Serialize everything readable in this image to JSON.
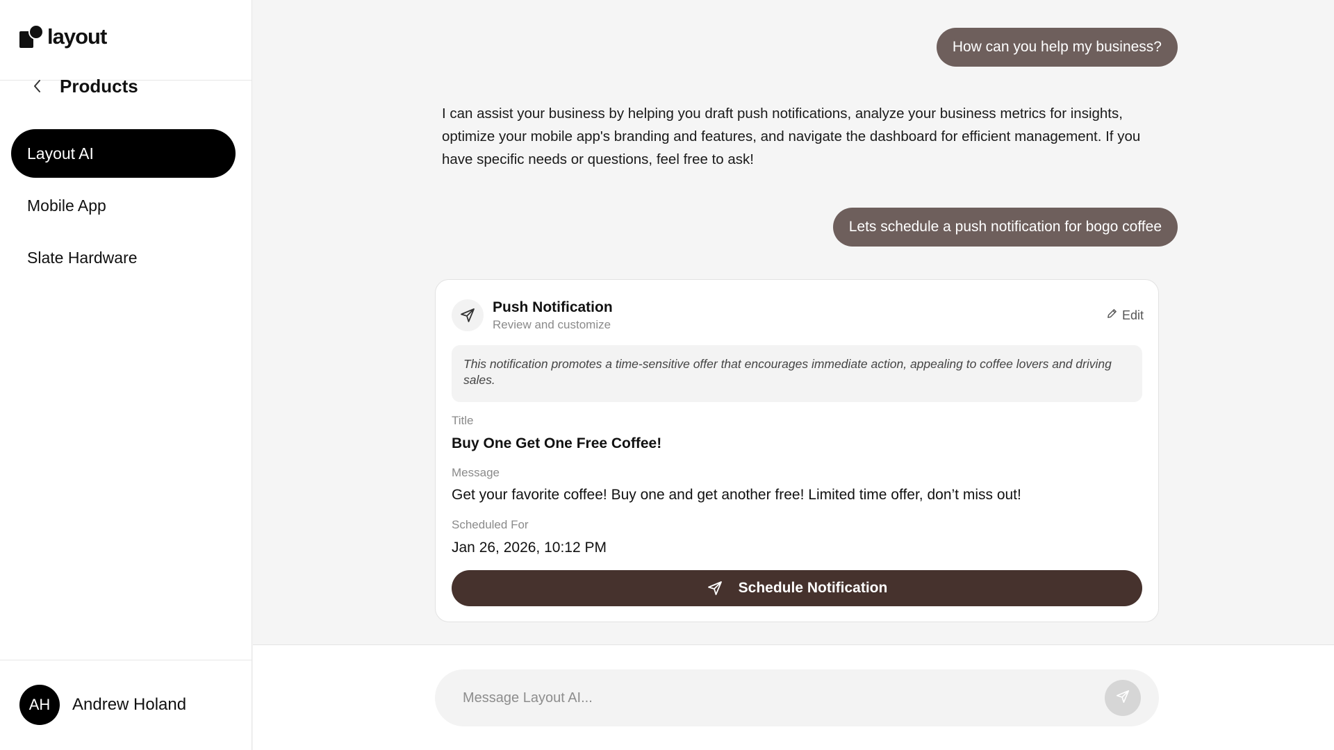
{
  "app": {
    "logo_text": "layout"
  },
  "sidebar": {
    "back_label": "Products",
    "items": [
      {
        "label": "Layout AI",
        "active": true
      },
      {
        "label": "Mobile App",
        "active": false
      },
      {
        "label": "Slate Hardware",
        "active": false
      }
    ],
    "user": {
      "initials": "AH",
      "name": "Andrew Holand"
    }
  },
  "chat": {
    "messages": [
      {
        "role": "user",
        "text": "How can you help my business?"
      },
      {
        "role": "assistant",
        "text": "I can assist your business by helping you draft push notifications, analyze your business metrics for insights, optimize your mobile app's branding and features, and navigate the dashboard for efficient management. If you have specific needs or questions, feel free to ask!"
      },
      {
        "role": "user",
        "text": "Lets schedule a push notification for bogo coffee"
      }
    ],
    "notification_card": {
      "icon": "send-icon",
      "heading": "Push Notification",
      "subheading": "Review and customize",
      "edit_label": "Edit",
      "summary": "This notification promotes a time-sensitive offer that encourages immediate action, appealing to coffee lovers and driving sales.",
      "title_label": "Title",
      "title_value": "Buy One Get One Free Coffee!",
      "message_label": "Message",
      "message_value": "Get your favorite coffee! Buy one and get another free! Limited time offer, don’t miss out!",
      "scheduled_label": "Scheduled For",
      "scheduled_value": "Jan 26, 2026, 10:12 PM",
      "button_label": "Schedule Notification"
    }
  },
  "composer": {
    "placeholder": "Message Layout AI..."
  },
  "colors": {
    "user_bubble": "#6e5f5c",
    "primary_button": "#46322d",
    "active_nav": "#000000"
  }
}
